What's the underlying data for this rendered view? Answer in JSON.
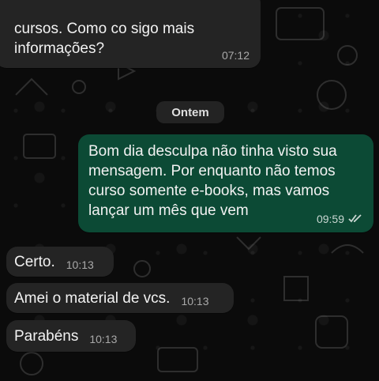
{
  "messages": [
    {
      "direction": "incoming",
      "text": "cursos. Como co sigo mais\ninformações?",
      "time": "07:12"
    },
    {
      "direction": "outgoing",
      "text": "Bom dia desculpa não tinha visto sua mensagem. Por enquanto não temos curso somente e-books, mas vamos lançar um mês que vem",
      "time": "09:59",
      "status_icon": "double-check-icon"
    },
    {
      "direction": "incoming",
      "text": "Certo.",
      "time": "10:13"
    },
    {
      "direction": "incoming",
      "text": "Amei o material de vcs.",
      "time": "10:13"
    },
    {
      "direction": "incoming",
      "text": "Parabéns",
      "time": "10:13"
    }
  ],
  "day_separator": "Ontem",
  "colors": {
    "incoming_bubble": "#242424",
    "outgoing_bubble": "#0c4a35",
    "background": "#0b0b0b"
  }
}
